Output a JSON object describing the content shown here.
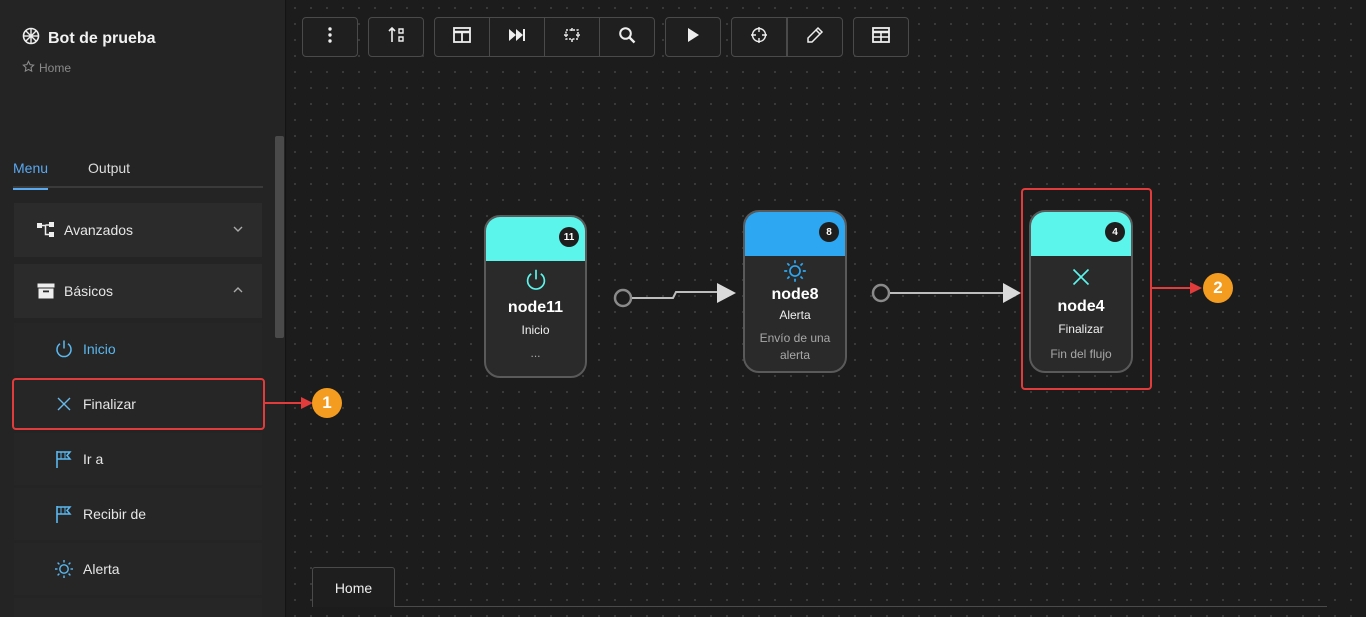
{
  "app": {
    "title": "Bot de prueba",
    "breadcrumb": "Home"
  },
  "tabs": [
    {
      "label": "Menu",
      "active": true
    },
    {
      "label": "Output",
      "active": false
    }
  ],
  "menu": {
    "groups": [
      {
        "label": "Avanzados",
        "icon": "flow-icon",
        "expanded": false
      },
      {
        "label": "Básicos",
        "icon": "archive-icon",
        "expanded": true
      }
    ],
    "items": [
      {
        "label": "Inicio",
        "icon": "power-icon",
        "active": true
      },
      {
        "label": "Finalizar",
        "icon": "close-icon"
      },
      {
        "label": "Ir a",
        "icon": "goto-icon"
      },
      {
        "label": "Recibir de",
        "icon": "receive-icon"
      },
      {
        "label": "Alerta",
        "icon": "sun-icon"
      }
    ]
  },
  "toolbar": [
    "more-icon",
    "sort-icon",
    "layout-icon",
    "skip-icon",
    "transform-icon",
    "search-icon",
    "play-icon",
    "crosshair-icon",
    "picker-icon",
    "table-icon"
  ],
  "nodes": [
    {
      "id": "node11",
      "label": "Inicio",
      "desc": "...",
      "count": "11",
      "icon": "power-icon",
      "color": "#5cf5ec"
    },
    {
      "id": "node8",
      "label": "Alerta",
      "desc": "Envío de una alerta",
      "count": "8",
      "icon": "sun-icon",
      "color": "#2ea7f2"
    },
    {
      "id": "node4",
      "label": "Finalizar",
      "desc": "Fin del flujo",
      "count": "4",
      "icon": "close-icon",
      "color": "#5cf5ec"
    }
  ],
  "annotations": [
    {
      "number": "1"
    },
    {
      "number": "2"
    }
  ],
  "bottom_tab": "Home",
  "colors": {
    "accent": "#5aa8f0",
    "highlight": "#e23b3b",
    "badge": "#f39c1f",
    "canvas": "#1c1c1c"
  }
}
